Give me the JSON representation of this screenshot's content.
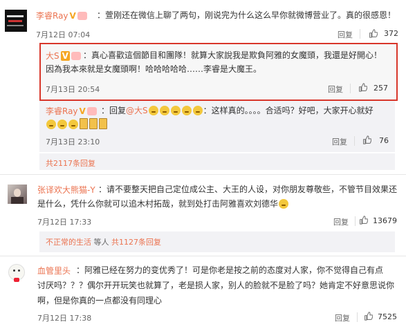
{
  "comment1": {
    "username": "李睿Ray",
    "vip": "V",
    "text": "：萱刚还在微信上聊了两句，刚说完为什么这么早你就微博营业了。真的很感恩！",
    "time": "7月12日 07:04",
    "reply_label": "回复",
    "likes": "372"
  },
  "reply1": {
    "username": "大S",
    "vip": "V",
    "text_line1": "：真心喜歡這個節目和團隊！就算大家說我是欺負阿雅的女魔頭，我還是好開心！",
    "text_line2": "因為我本來就是女魔頭啊！哈哈哈哈哈……李睿是大魔王。",
    "time": "7月13日 20:54",
    "reply_label": "回复",
    "likes": "257"
  },
  "reply2": {
    "username": "李睿Ray",
    "vip": "V",
    "text_prefix": "：回复",
    "mention": "@大S",
    "text_line1_suffix": "：这样真的。。。。合适吗？好吧，大家开心就好",
    "time": "7月13日 23:10",
    "reply_label": "回复",
    "likes": "76"
  },
  "more_replies1": "共2117条回复",
  "comment2": {
    "username": "张译欢大熊猫-Y",
    "text_line1": "：请不要整天把自己定位成公主、大王的人设，对你朋友尊敬些，不管节目效果还",
    "text_line2": "是什么，凭什么你就可以追木村拓哉，就到处打击阿雅喜欢刘德华",
    "time": "7月12日 17:33",
    "reply_label": "回复",
    "likes": "13679",
    "replier": "不正常的生活",
    "replier_suffix": "等人",
    "more_replies": "共1127条回复"
  },
  "comment3": {
    "username": "血管里头",
    "text_line1": "：阿雅已经在努力的变优秀了！可是你老是按之前的态度对人家，你不觉得自己有点",
    "text_line2": "讨厌吗？？？偶尔开开玩笑也就算了，老是损人家，别人的脸就不是脸了吗？她肯定不好意思说你",
    "text_line3": "啊，但是你真的一点都没有同理心",
    "time": "7月12日 17:38",
    "reply_label": "回复",
    "likes": "7525"
  },
  "icons": {
    "like": "thumbs-up-icon"
  }
}
